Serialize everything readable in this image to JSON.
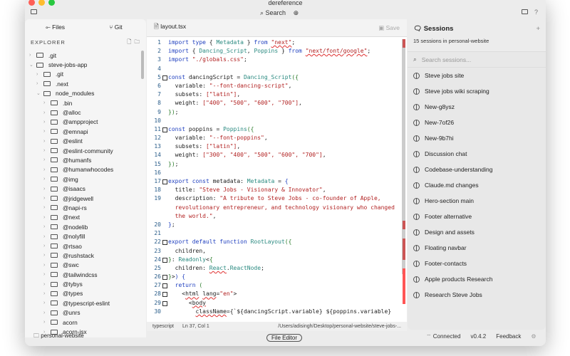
{
  "window": {
    "title": "dereference",
    "search_label": "Search",
    "help": "?"
  },
  "sidebar": {
    "tab_files": "Files",
    "tab_git": "Git",
    "explorer_label": "EXPLORER",
    "project": "personal-website",
    "tree": [
      {
        "label": ".git",
        "depth": 0,
        "open": false
      },
      {
        "label": "steve-jobs-app",
        "depth": 0,
        "open": true
      },
      {
        "label": ".git",
        "depth": 1,
        "open": false
      },
      {
        "label": ".next",
        "depth": 1,
        "open": false
      },
      {
        "label": "node_modules",
        "depth": 1,
        "open": true
      },
      {
        "label": ".bin",
        "depth": 2
      },
      {
        "label": "@alloc",
        "depth": 2
      },
      {
        "label": "@ampproject",
        "depth": 2
      },
      {
        "label": "@emnapi",
        "depth": 2
      },
      {
        "label": "@eslint",
        "depth": 2
      },
      {
        "label": "@eslint-community",
        "depth": 2
      },
      {
        "label": "@humanfs",
        "depth": 2
      },
      {
        "label": "@humanwhocodes",
        "depth": 2
      },
      {
        "label": "@img",
        "depth": 2
      },
      {
        "label": "@isaacs",
        "depth": 2
      },
      {
        "label": "@jridgewell",
        "depth": 2
      },
      {
        "label": "@napi-rs",
        "depth": 2
      },
      {
        "label": "@next",
        "depth": 2
      },
      {
        "label": "@nodelib",
        "depth": 2
      },
      {
        "label": "@nolyfill",
        "depth": 2
      },
      {
        "label": "@rtsao",
        "depth": 2
      },
      {
        "label": "@rushstack",
        "depth": 2
      },
      {
        "label": "@swc",
        "depth": 2
      },
      {
        "label": "@tailwindcss",
        "depth": 2
      },
      {
        "label": "@tybys",
        "depth": 2
      },
      {
        "label": "@types",
        "depth": 2
      },
      {
        "label": "@typescript-eslint",
        "depth": 2
      },
      {
        "label": "@unrs",
        "depth": 2
      },
      {
        "label": "acorn",
        "depth": 2
      },
      {
        "label": "acorn-jsx",
        "depth": 2
      }
    ]
  },
  "editor": {
    "filename": "layout.tsx",
    "save_label": "Save",
    "lines": [
      [
        1,
        0,
        [
          [
            "k",
            "import type "
          ],
          [
            "d",
            "{ "
          ],
          [
            "t",
            "Metadata"
          ],
          [
            "d",
            " } "
          ],
          [
            "k",
            "from "
          ],
          [
            "sw",
            "\"next\""
          ],
          [
            "d",
            ";"
          ]
        ]
      ],
      [
        2,
        0,
        [
          [
            "k",
            "import "
          ],
          [
            "d",
            "{ "
          ],
          [
            "t",
            "Dancing_Script"
          ],
          [
            "d",
            ", "
          ],
          [
            "t",
            "Poppins"
          ],
          [
            "d",
            " } "
          ],
          [
            "k",
            "from "
          ],
          [
            "sw",
            "\"next/font/google\""
          ],
          [
            "d",
            ";"
          ]
        ]
      ],
      [
        3,
        0,
        [
          [
            "k",
            "import "
          ],
          [
            "s",
            "\"./globals.css\""
          ],
          [
            "d",
            ";"
          ]
        ]
      ],
      [
        4,
        0,
        []
      ],
      [
        5,
        1,
        [
          [
            "k",
            "const "
          ],
          [
            "d",
            "dancingScript = "
          ],
          [
            "t",
            "Dancing_Script"
          ],
          [
            "p",
            "({"
          ]
        ]
      ],
      [
        6,
        0,
        [
          [
            "d",
            "  variable: "
          ],
          [
            "s",
            "\"--font-dancing-script\""
          ],
          [
            "d",
            ","
          ]
        ]
      ],
      [
        7,
        0,
        [
          [
            "d",
            "  subsets: "
          ],
          [
            "s",
            "[\"latin\"]"
          ],
          [
            "d",
            ","
          ]
        ]
      ],
      [
        8,
        0,
        [
          [
            "d",
            "  weight: "
          ],
          [
            "s",
            "[\"400\", \"500\", \"600\", \"700\"]"
          ],
          [
            "d",
            ","
          ]
        ]
      ],
      [
        9,
        0,
        [
          [
            "p",
            "})"
          ],
          [
            "d",
            ";"
          ]
        ]
      ],
      [
        10,
        0,
        []
      ],
      [
        11,
        1,
        [
          [
            "k",
            "const "
          ],
          [
            "d",
            "poppins = "
          ],
          [
            "t",
            "Poppins"
          ],
          [
            "p",
            "({"
          ]
        ]
      ],
      [
        12,
        0,
        [
          [
            "d",
            "  variable: "
          ],
          [
            "s",
            "\"--font-poppins\""
          ],
          [
            "d",
            ","
          ]
        ]
      ],
      [
        13,
        0,
        [
          [
            "d",
            "  subsets: "
          ],
          [
            "s",
            "[\"latin\"]"
          ],
          [
            "d",
            ","
          ]
        ]
      ],
      [
        14,
        0,
        [
          [
            "d",
            "  weight: "
          ],
          [
            "s",
            "[\"300\", \"400\", \"500\", \"600\", \"700\"]"
          ],
          [
            "d",
            ","
          ]
        ]
      ],
      [
        15,
        0,
        [
          [
            "p",
            "})"
          ],
          [
            "d",
            ";"
          ]
        ]
      ],
      [
        16,
        0,
        []
      ],
      [
        17,
        1,
        [
          [
            "k",
            "export const "
          ],
          [
            "d",
            "metadata: "
          ],
          [
            "t",
            "Metadata"
          ],
          [
            "d",
            " = "
          ],
          [
            "k",
            "{"
          ]
        ]
      ],
      [
        18,
        0,
        [
          [
            "d",
            "  title: "
          ],
          [
            "s",
            "\"Steve Jobs - Visionary & Innovator\""
          ],
          [
            "d",
            ","
          ]
        ]
      ],
      [
        19,
        0,
        [
          [
            "d",
            "  description: "
          ],
          [
            "s",
            "\"A tribute to Steve Jobs - co-founder of Apple,"
          ]
        ]
      ],
      [
        "",
        0,
        [
          [
            "s",
            "  revolutionary entrepreneur, and technology visionary who changed"
          ]
        ]
      ],
      [
        "",
        0,
        [
          [
            "s",
            "  the world.\""
          ],
          [
            "d",
            ","
          ]
        ]
      ],
      [
        20,
        0,
        [
          [
            "k",
            "}"
          ],
          [
            "d",
            ";"
          ]
        ]
      ],
      [
        21,
        0,
        []
      ],
      [
        22,
        1,
        [
          [
            "k",
            "export default function "
          ],
          [
            "t",
            "RootLayout"
          ],
          [
            "p",
            "({"
          ]
        ]
      ],
      [
        23,
        0,
        [
          [
            "d",
            "  children,"
          ]
        ]
      ],
      [
        24,
        1,
        [
          [
            "p",
            "}"
          ],
          [
            "d",
            ": "
          ],
          [
            "t",
            "Readonly"
          ],
          [
            "d",
            "<"
          ],
          [
            "p",
            "{"
          ]
        ]
      ],
      [
        25,
        0,
        [
          [
            "d",
            "  children: "
          ],
          [
            "tw",
            "React"
          ],
          [
            "d",
            "."
          ],
          [
            "t",
            "ReactNode"
          ],
          [
            "d",
            ";"
          ]
        ]
      ],
      [
        26,
        1,
        [
          [
            "p",
            "}"
          ],
          [
            "d",
            ">"
          ],
          [
            "k",
            ") {"
          ]
        ]
      ],
      [
        27,
        1,
        [
          [
            "k",
            "  return "
          ],
          [
            "p",
            "("
          ]
        ]
      ],
      [
        28,
        1,
        [
          [
            "d",
            "    <"
          ],
          [
            "dw",
            "html"
          ],
          [
            "d",
            " "
          ],
          [
            "dw",
            "lang"
          ],
          [
            "d",
            "="
          ],
          [
            "s",
            "\"en\""
          ],
          [
            "d",
            ">"
          ]
        ]
      ],
      [
        29,
        1,
        [
          [
            "d",
            "      <"
          ],
          [
            "dw",
            "body"
          ]
        ]
      ],
      [
        30,
        0,
        [
          [
            "d",
            "        "
          ],
          [
            "dw",
            "className"
          ],
          [
            "d",
            "={`${dancingScript.variable} ${poppins.variable}"
          ]
        ]
      ]
    ]
  },
  "status": {
    "language": "typescript",
    "position": "Ln 37, Col 1",
    "path": "/Users/adisingh/Desktop/personal-website/steve-jobs-...",
    "mode": "File Editor"
  },
  "sessions": {
    "title": "Sessions",
    "subtitle": "15 sessions in personal-website",
    "search_placeholder": "Search sessions...",
    "items": [
      "Steve jobs site",
      "Steve jobs wiki scraping",
      "New-g8ysz",
      "New-7of26",
      "New-9b7hi",
      "Discussion chat",
      "Codebase-understanding",
      "Claude.md changes",
      "Hero-section main",
      "Footer alternative",
      "Design and assets",
      "Floating navbar",
      "Footer-contacts",
      "Apple products Research",
      "Research Steve Jobs"
    ]
  },
  "footer": {
    "connection": "Connected",
    "version": "v0.4.2",
    "feedback": "Feedback"
  }
}
